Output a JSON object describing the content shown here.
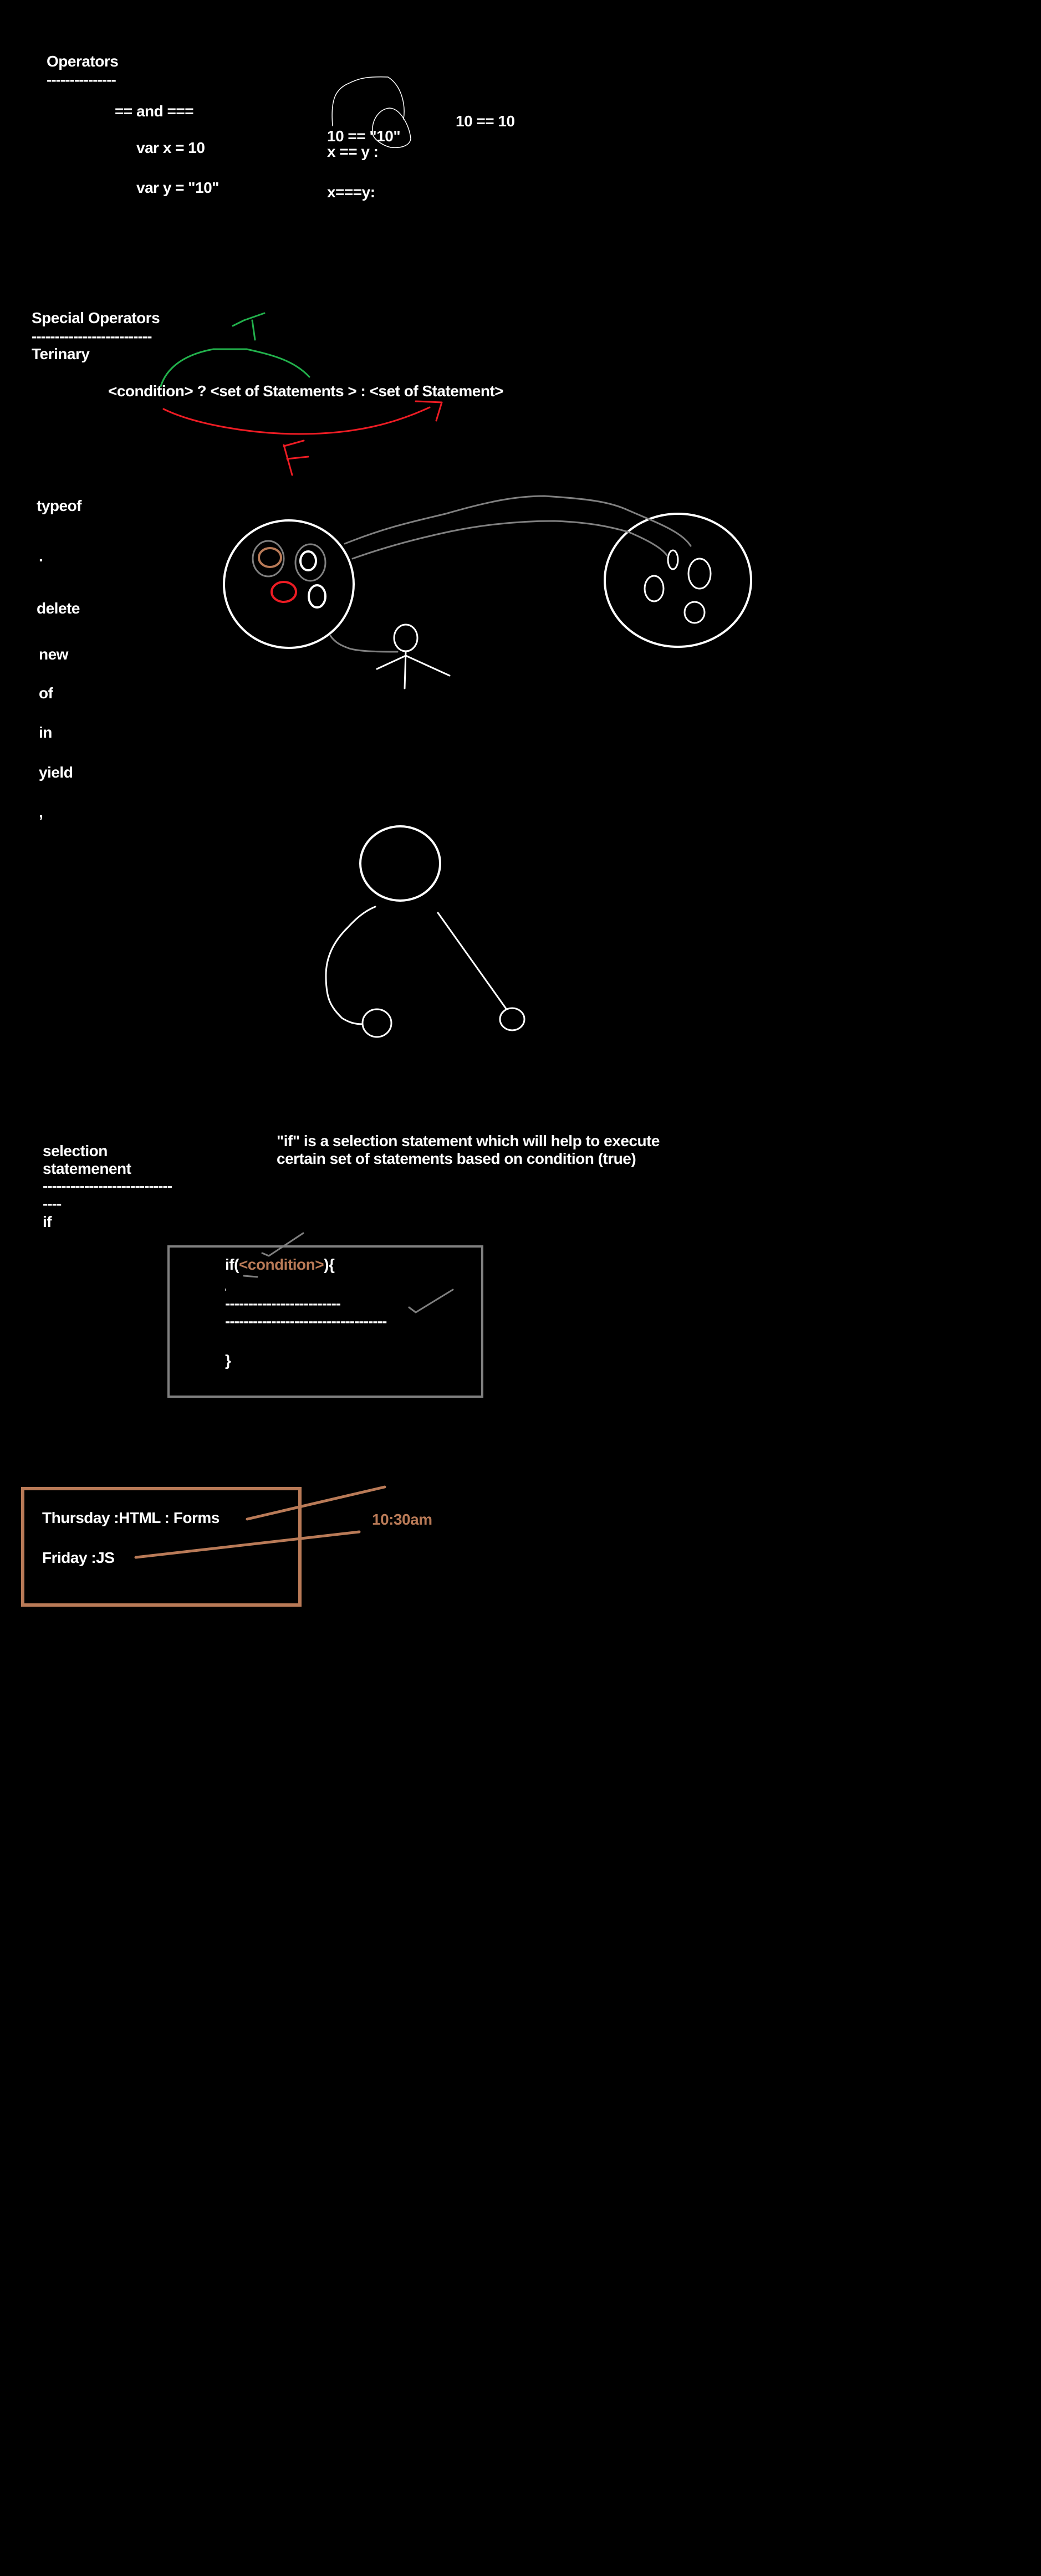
{
  "colors": {
    "background": "#000000",
    "text": "#ffffff",
    "accent_brown": "#b97a57",
    "green": "#22b14c",
    "red": "#ed1c24",
    "gray": "#7f7f7f"
  },
  "operators": {
    "title": "Operators",
    "underline": "---------------",
    "subtitle": "== and ===",
    "var_x": "var x = 10",
    "var_y": "var y = \"10\"",
    "expr_loose": "10 == \"10\"",
    "expr_xy": "x == y :",
    "expr_strict": "x===y:",
    "expr_equal": "10 == 10"
  },
  "special": {
    "title": "Special Operators",
    "underline": "--------------------------",
    "ternary_label": "Terinary",
    "ternary_syntax": "<condition> ? <set of Statements > : <set of Statement>",
    "true_mark": "T",
    "false_mark": "F"
  },
  "keywords": [
    "typeof",
    ".",
    "delete",
    "new",
    "of",
    "in",
    "yield",
    ","
  ],
  "selection": {
    "title_line1": "selection",
    "title_line2": "statemenent",
    "underline1": "----------------------------",
    "underline2": "----",
    "keyword": "if",
    "description_line1": "\"if\" is a selection statement which will help to execute",
    "description_line2": "certain set of statements based on condition (true)",
    "code": {
      "open_prefix": "if(",
      "condition": "<condition>",
      "open_suffix": "){",
      "tick": "'",
      "line1": "-------------------------",
      "line2": "-----------------------------------",
      "close": "}"
    }
  },
  "schedule": {
    "thursday": "Thursday :HTML : Forms",
    "friday": "Friday :JS",
    "time": "10:30am"
  }
}
